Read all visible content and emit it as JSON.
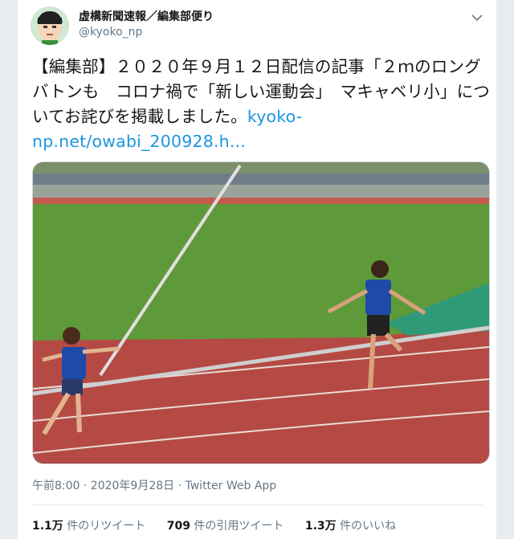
{
  "tweet": {
    "display_name": "虚構新聞速報／編集部便り",
    "handle": "@kyoko_np",
    "text_main": "【編集部】２０２０年９月１２日配信の記事「２ｍのロングバトンも　コロナ禍で「新しい運動会」　マキャベリ小」についてお詫びを掲載しました。",
    "link": "kyoko-np.net/owabi_200928.h...",
    "meta": "午前8:00 · 2020年9月28日 · Twitter Web App"
  },
  "stats": {
    "retweets_count": "1.1万",
    "retweets_label": "件のリツイート",
    "quotes_count": "709",
    "quotes_label": "件の引用ツイート",
    "likes_count": "1.3万",
    "likes_label": "件のいいね"
  },
  "icons": [
    "avatar-icon",
    "chevron-down-icon"
  ],
  "colors": {
    "link": "#1b95e0",
    "muted": "#657786",
    "track": "#b54a45",
    "field": "#5f9a3a"
  }
}
